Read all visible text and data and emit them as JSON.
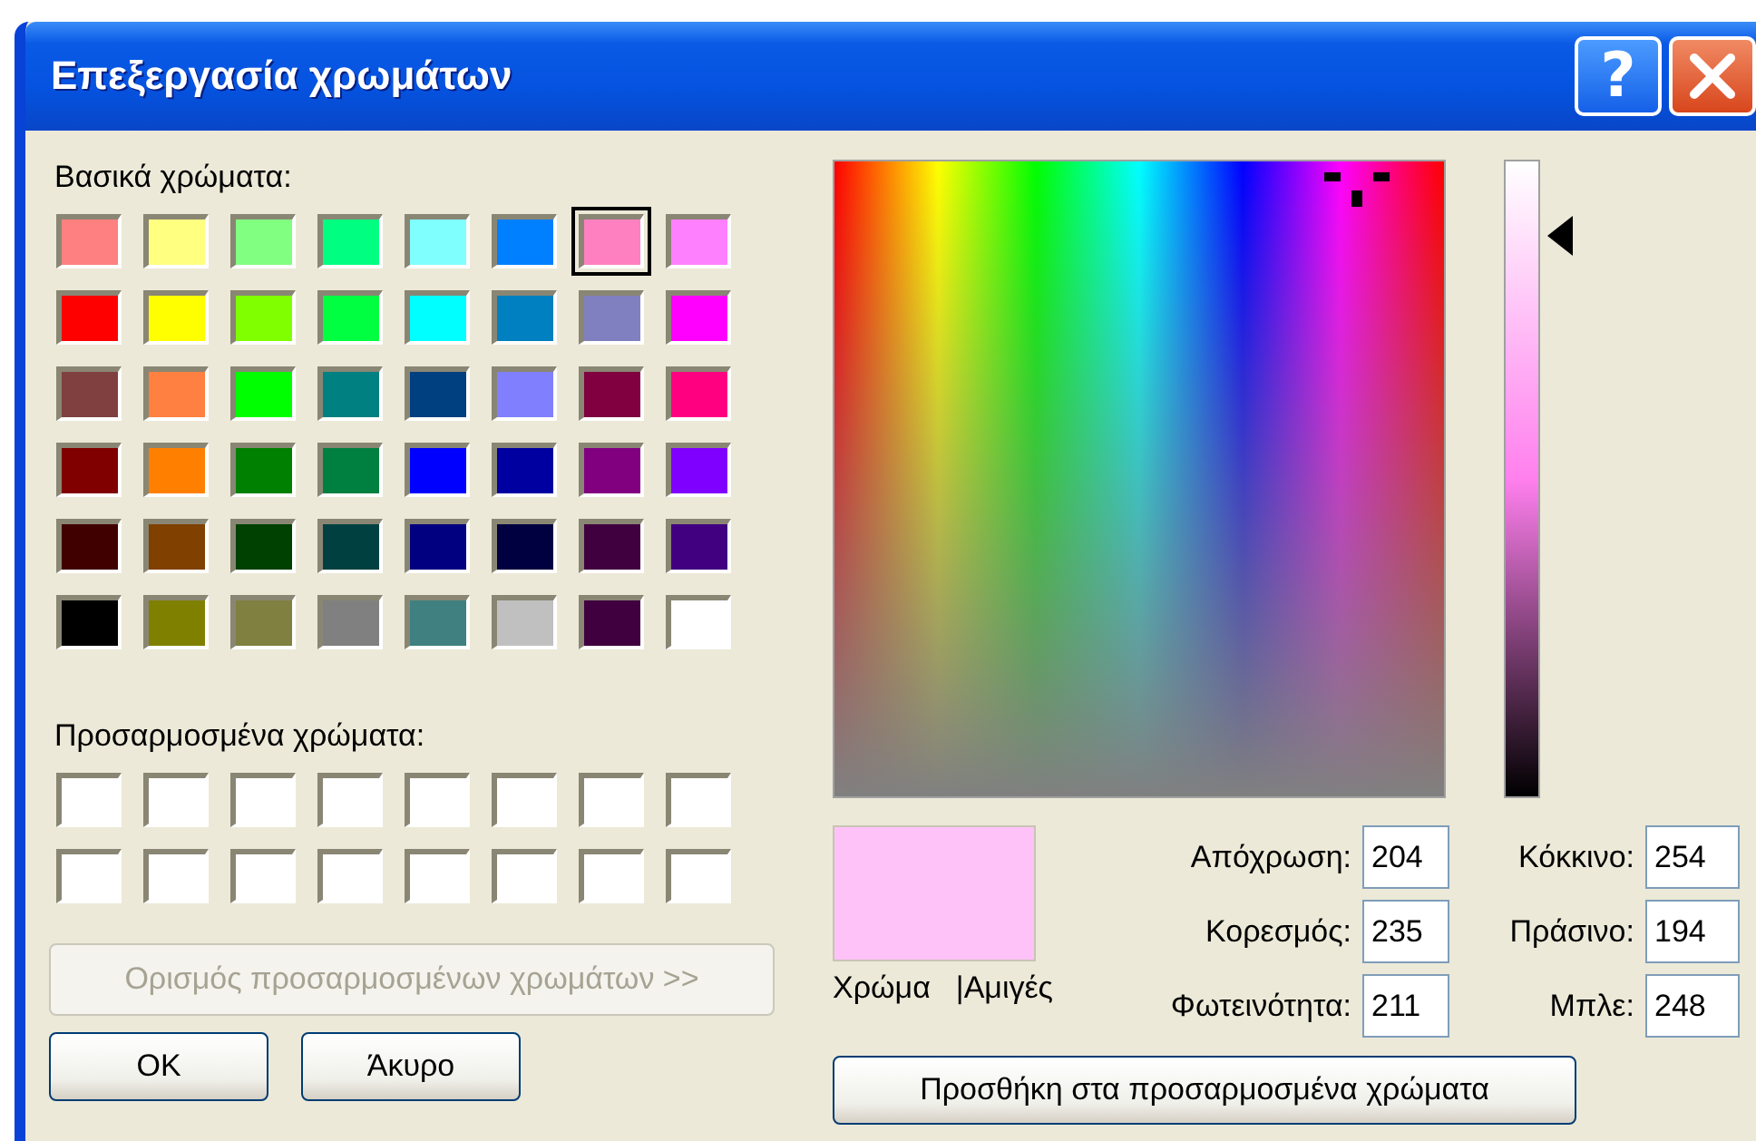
{
  "window": {
    "title": "Επεξεργασία χρωμάτων",
    "help_button": "?"
  },
  "basic_colors": {
    "label": "Βασικά χρώματα:",
    "swatches": [
      {
        "color": "#ff8080",
        "selected": false
      },
      {
        "color": "#ffff80",
        "selected": false
      },
      {
        "color": "#80ff80",
        "selected": false
      },
      {
        "color": "#00ff80",
        "selected": false
      },
      {
        "color": "#80ffff",
        "selected": false
      },
      {
        "color": "#0080ff",
        "selected": false
      },
      {
        "color": "#ff80c0",
        "selected": true
      },
      {
        "color": "#ff80ff",
        "selected": false
      },
      {
        "color": "#ff0000",
        "selected": false
      },
      {
        "color": "#ffff00",
        "selected": false
      },
      {
        "color": "#80ff00",
        "selected": false
      },
      {
        "color": "#00ff40",
        "selected": false
      },
      {
        "color": "#00ffff",
        "selected": false
      },
      {
        "color": "#0080c0",
        "selected": false
      },
      {
        "color": "#8080c0",
        "selected": false
      },
      {
        "color": "#ff00ff",
        "selected": false
      },
      {
        "color": "#804040",
        "selected": false
      },
      {
        "color": "#ff8040",
        "selected": false
      },
      {
        "color": "#00ff00",
        "selected": false
      },
      {
        "color": "#008080",
        "selected": false
      },
      {
        "color": "#004080",
        "selected": false
      },
      {
        "color": "#8080ff",
        "selected": false
      },
      {
        "color": "#800040",
        "selected": false
      },
      {
        "color": "#ff0080",
        "selected": false
      },
      {
        "color": "#800000",
        "selected": false
      },
      {
        "color": "#ff8000",
        "selected": false
      },
      {
        "color": "#008000",
        "selected": false
      },
      {
        "color": "#008040",
        "selected": false
      },
      {
        "color": "#0000ff",
        "selected": false
      },
      {
        "color": "#0000a0",
        "selected": false
      },
      {
        "color": "#800080",
        "selected": false
      },
      {
        "color": "#8000ff",
        "selected": false
      },
      {
        "color": "#400000",
        "selected": false
      },
      {
        "color": "#804000",
        "selected": false
      },
      {
        "color": "#004000",
        "selected": false
      },
      {
        "color": "#004040",
        "selected": false
      },
      {
        "color": "#000080",
        "selected": false
      },
      {
        "color": "#000040",
        "selected": false
      },
      {
        "color": "#400040",
        "selected": false
      },
      {
        "color": "#400080",
        "selected": false
      },
      {
        "color": "#000000",
        "selected": false
      },
      {
        "color": "#808000",
        "selected": false
      },
      {
        "color": "#808040",
        "selected": false
      },
      {
        "color": "#808080",
        "selected": false
      },
      {
        "color": "#408080",
        "selected": false
      },
      {
        "color": "#c0c0c0",
        "selected": false
      },
      {
        "color": "#400040",
        "selected": false
      },
      {
        "color": "#ffffff",
        "selected": false
      }
    ]
  },
  "custom_colors": {
    "label": "Προσαρμοσμένα χρώματα:",
    "swatches": [
      {
        "color": "#ffffff",
        "selected": false
      },
      {
        "color": "#ffffff",
        "selected": false
      },
      {
        "color": "#ffffff",
        "selected": false
      },
      {
        "color": "#ffffff",
        "selected": false
      },
      {
        "color": "#ffffff",
        "selected": false
      },
      {
        "color": "#ffffff",
        "selected": false
      },
      {
        "color": "#ffffff",
        "selected": false
      },
      {
        "color": "#ffffff",
        "selected": false
      },
      {
        "color": "#ffffff",
        "selected": false
      },
      {
        "color": "#ffffff",
        "selected": false
      },
      {
        "color": "#ffffff",
        "selected": false
      },
      {
        "color": "#ffffff",
        "selected": false
      },
      {
        "color": "#ffffff",
        "selected": false
      },
      {
        "color": "#ffffff",
        "selected": false
      },
      {
        "color": "#ffffff",
        "selected": false
      },
      {
        "color": "#ffffff",
        "selected": false
      }
    ]
  },
  "define_custom_button": {
    "label": "Ορισμός προσαρμοσμένων χρωμάτων >>",
    "disabled": true
  },
  "ok_button": "OK",
  "cancel_button": "Άκυρο",
  "luminance_slider": {
    "level": 0.88
  },
  "preview": {
    "color": "#fec2f8",
    "labels": [
      {
        "text": "Χρώμα"
      },
      {
        "text": "|Αμιγές"
      }
    ]
  },
  "fields": [
    {
      "label": "Απόχρωση:",
      "value": "204"
    },
    {
      "label": "Κόκκινο:",
      "value": "254"
    },
    {
      "label": "Κορεσμός:",
      "value": "235"
    },
    {
      "label": "Πράσινο:",
      "value": "194"
    },
    {
      "label": "Φωτεινότητα:",
      "value": "211"
    },
    {
      "label": "Μπλε:",
      "value": "248"
    }
  ],
  "add_button": {
    "label": "Προσθήκη στα προσαρμοσμένα χρώματα"
  }
}
